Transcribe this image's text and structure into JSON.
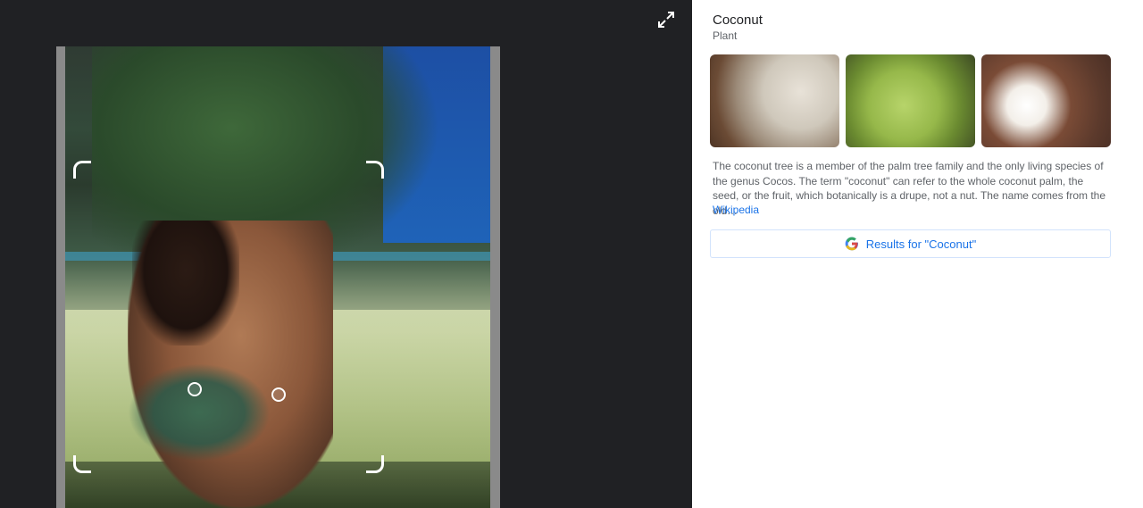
{
  "viewer": {
    "expand_icon": "expand-icon"
  },
  "knowledge_panel": {
    "title": "Coconut",
    "subtitle": "Plant",
    "description": "The coconut tree is a member of the palm tree family and the only living species of the genus Cocos. The term \"coconut\" can refer to the whole coconut palm, the seed, or the fruit, which botanically is a drupe, not a nut. The name comes from the old…",
    "source_label": "Wikipedia",
    "results_button_label": "Results for \"Coconut\""
  },
  "colors": {
    "link_blue": "#1a73e8",
    "viewer_bg": "#202124",
    "panel_bg": "#ffffff",
    "text_primary": "#202124",
    "text_secondary": "#5f6368"
  }
}
